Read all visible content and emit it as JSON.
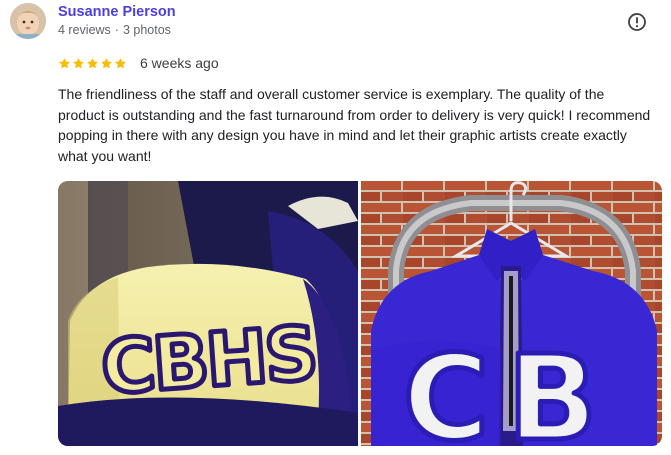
{
  "review": {
    "author": {
      "name": "Susanne Pierson",
      "reviews_count": "4 reviews",
      "separator": "·",
      "photos_count": "3 photos",
      "avatar_icon": "baby-avatar"
    },
    "rating": {
      "stars": 5,
      "max": 5,
      "color": "#fbbc04"
    },
    "date": "6 weeks ago",
    "text": "The friendliness of the staff and overall customer service is exemplary. The quality of the product is outstanding and the fast turnaround from order to delivery is very quick! I recommend popping in there with any design you have in mind and let their graphic artists create exactly what you want!",
    "report_icon": "alert-circle-icon",
    "photos": [
      {
        "subject": "cap",
        "embroidery": "CBHS"
      },
      {
        "subject": "jacket",
        "embroidery": "CB"
      }
    ]
  },
  "colors": {
    "name_link": "#4a3fe0",
    "meta_text": "#5f6368",
    "body_text": "#202124",
    "star": "#fbbc04",
    "royal_blue": "#3b28d4",
    "cap_yellow": "#f3ec9a"
  }
}
